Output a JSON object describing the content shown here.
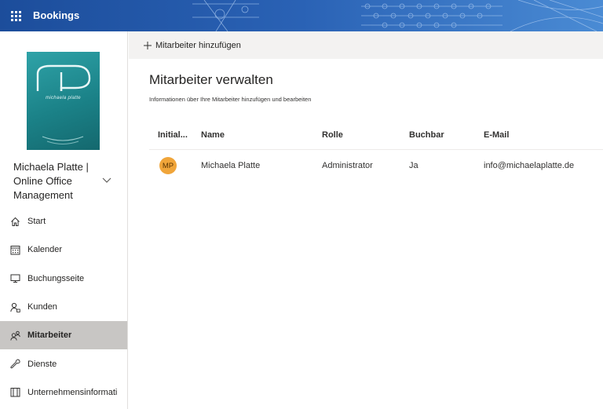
{
  "header": {
    "app_name": "Bookings"
  },
  "sidebar": {
    "logo_text": "michaela platte",
    "business_name": "Michaela Platte | Online Office Management",
    "items": [
      {
        "label": "Start",
        "icon": "home-icon"
      },
      {
        "label": "Kalender",
        "icon": "calendar-icon"
      },
      {
        "label": "Buchungsseite",
        "icon": "monitor-icon"
      },
      {
        "label": "Kunden",
        "icon": "customers-icon"
      },
      {
        "label": "Mitarbeiter",
        "icon": "staff-icon",
        "active": true
      },
      {
        "label": "Dienste",
        "icon": "services-icon"
      },
      {
        "label": "Unternehmensinformati",
        "icon": "business-info-icon"
      }
    ]
  },
  "command_bar": {
    "add_label": "Mitarbeiter hinzufügen"
  },
  "main": {
    "title": "Mitarbeiter verwalten",
    "subtitle": "Informationen über Ihre Mitarbeiter hinzufügen und bearbeiten",
    "columns": [
      "Initial...",
      "Name",
      "Rolle",
      "Buchbar",
      "E-Mail"
    ],
    "rows": [
      {
        "initials": "MP",
        "name": "Michaela Platte",
        "role": "Administrator",
        "bookable": "Ja",
        "email": "info@michaelaplatte.de"
      }
    ]
  },
  "colors": {
    "header": "#1d4f9e",
    "avatar": "#f0a53a",
    "active_nav": "#c8c6c4",
    "logo": "#1b8288"
  }
}
